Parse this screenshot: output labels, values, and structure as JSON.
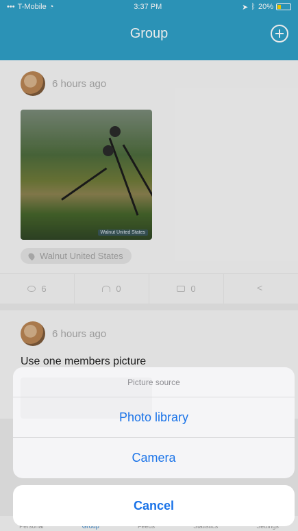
{
  "status": {
    "carrier": "T-Mobile",
    "time": "3:37 PM",
    "battery": "20%"
  },
  "nav": {
    "title": "Group"
  },
  "posts": [
    {
      "time": "6 hours ago",
      "photo_label": "Walnut United States",
      "location": "Walnut United States",
      "views": "6",
      "likes": "0",
      "comments": "0"
    },
    {
      "time": "6 hours ago",
      "caption": "Use one members picture"
    }
  ],
  "tabs": [
    "Personal",
    "Group",
    "Feeds",
    "Statistics",
    "Settings"
  ],
  "sheet": {
    "title": "Picture source",
    "options": [
      "Photo library",
      "Camera"
    ],
    "cancel": "Cancel"
  },
  "colors": {
    "nav": "#2f9fc6",
    "action_blue": "#1a73e8"
  }
}
